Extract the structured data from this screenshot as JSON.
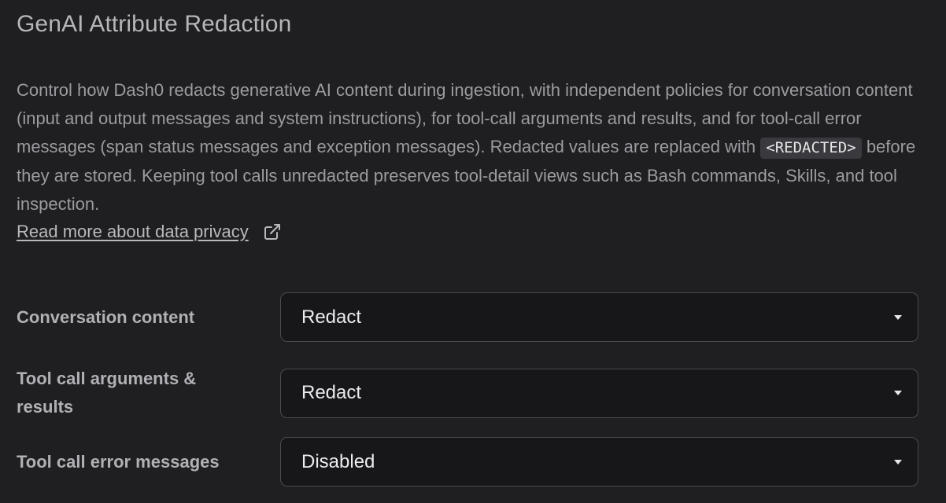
{
  "section": {
    "title": "GenAI Attribute Redaction",
    "description_before_code": "Control how Dash0 redacts generative AI content during ingestion, with independent policies for conversation content (input and output messages and system instructions), for tool-call arguments and results, and for tool-call error messages (span status messages and exception messages). Redacted values are replaced with",
    "code_token": "<REDACTED>",
    "description_after_code": "before they are stored. Keeping tool calls unredacted preserves tool-detail views such as Bash commands, Skills, and tool inspection.",
    "link_text": "Read more about data privacy",
    "link_icon": "external-link-icon"
  },
  "settings": [
    {
      "label": "Conversation content",
      "value": "Redact"
    },
    {
      "label": "Tool call arguments & results",
      "value": "Redact"
    },
    {
      "label": "Tool call error messages",
      "value": "Disabled"
    }
  ],
  "colors": {
    "background": "#1f1f22",
    "select_background": "#17171a",
    "select_border": "#4a4a50",
    "code_background": "#3a3a3e"
  }
}
